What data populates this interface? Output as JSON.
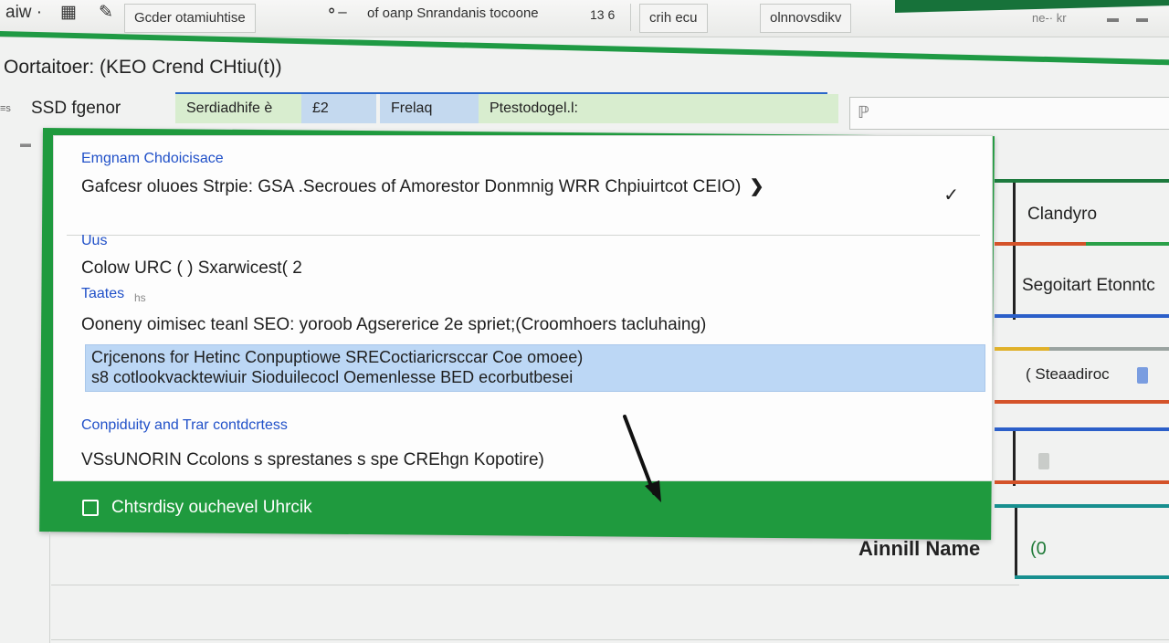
{
  "toolbar": {
    "item_1": "aiw ·",
    "item_2": "Gcder otamiuhtise",
    "item_3": "of oanp Snrandanis tocoone",
    "item_4": "13 6",
    "item_5": "crih ecu",
    "item_6": "olnnovsdikv",
    "item_7": "ne-· kr"
  },
  "page_title": "Oortaitoer: (KEO Crend CHtiu(t))",
  "filters": {
    "small_label": "≡s",
    "label": "SSD fgenor",
    "seg_1": "Serdiadhife è",
    "seg_2": "£2",
    "seg_3": "Frelaq",
    "seg_4": "Ptestodogel.l:"
  },
  "card": {
    "section_1_head": "Emgnam Chdoicisace",
    "row_1": "Gafcesr oluoes Strpie: GSA .Secroues of Amorestor Donmnig WRR  Chpiuirtcot CEIO)",
    "section_2_head": "Uus",
    "row_2": "Colow URC ( ) Sxarwicest( 2",
    "section_3_head": "Taates",
    "section_3_hint": "hs",
    "row_3": "Ooneny oimisec teanl SEO: yoroob Agsererice 2e spriet;(Croomhoers tacluhaing)",
    "highlight_line_1": "Crjcenons for Hetinc Conpuptiowe SRECoctiaricrsccar Coe omoee)",
    "highlight_line_2": "s8 cotlookvacktewiuir Sioduilecocl Oemenlesse BED ecorbutbesei",
    "section_4_head": "Conpiduity and Trar contdcrtess",
    "row_4": "VSsUNORIN Ccolons s sprestanes s spe CREhgn Kopotire)"
  },
  "footer": {
    "checkbox_label": "Chtsrdisy ouchevel Uhrcik",
    "checked": false
  },
  "right_panel": {
    "label_1": "Clandyro",
    "label_2": "Segoitart Etonntc",
    "label_3": "( Steaadiroc",
    "bracket": "("
  },
  "lower": {
    "name_label": "Ainnill Name",
    "name_value": "(0"
  },
  "colors": {
    "panel_green": "#1f9a3e",
    "accent_blue": "#2050c8",
    "highlight_blue": "#bcd7f5",
    "stripe_orange": "#d4532a",
    "stripe_yellow": "#e0b12a",
    "stripe_teal": "#178f8f"
  }
}
